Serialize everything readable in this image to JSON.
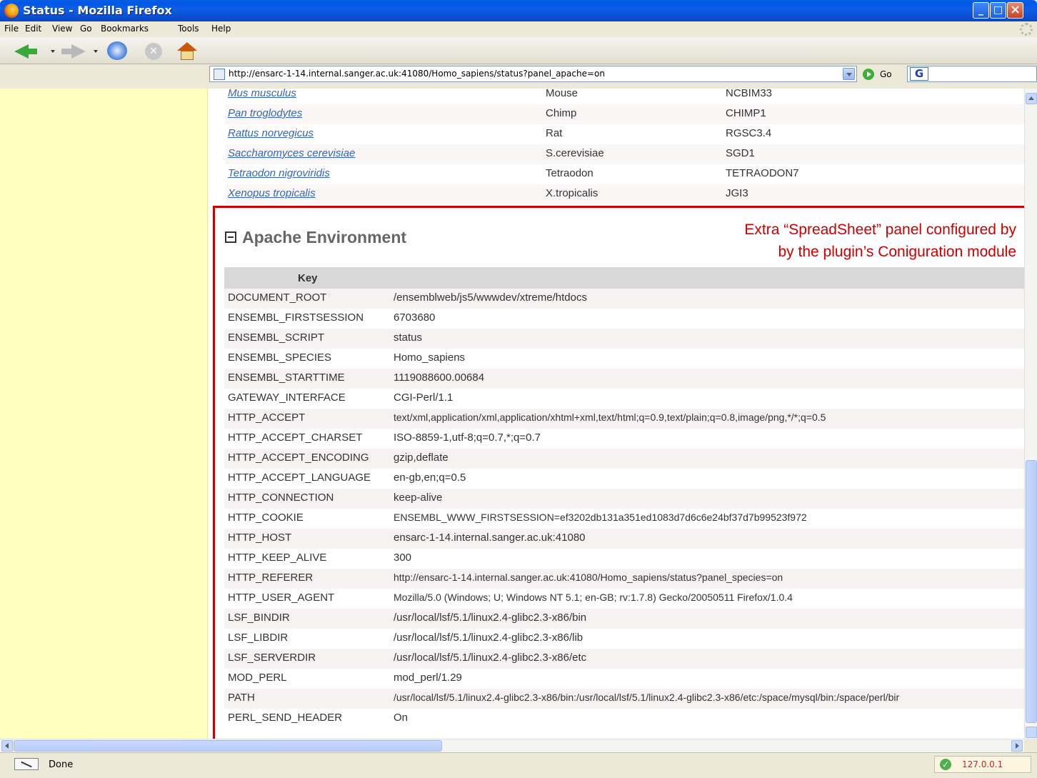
{
  "window": {
    "title": "Status - Mozilla Firefox"
  },
  "menu": [
    "File",
    "Edit",
    "View",
    "Go",
    "Bookmarks",
    "Tools",
    "Help"
  ],
  "toolbar": {
    "url": "http://ensarc-1-14.internal.sanger.ac.uk:41080/Homo_sapiens/status?panel_apache=on",
    "go_label": "Go",
    "search_logo": "G"
  },
  "species": [
    {
      "name": "Mus musculus",
      "common": "Mouse",
      "assembly": "NCBIM33"
    },
    {
      "name": "Pan troglodytes",
      "common": "Chimp",
      "assembly": "CHIMP1"
    },
    {
      "name": "Rattus norvegicus",
      "common": "Rat",
      "assembly": "RGSC3.4"
    },
    {
      "name": "Saccharomyces cerevisiae",
      "common": "S.cerevisiae",
      "assembly": "SGD1"
    },
    {
      "name": "Tetraodon nigroviridis",
      "common": "Tetraodon",
      "assembly": "TETRAODON7"
    },
    {
      "name": "Xenopus tropicalis",
      "common": "X.tropicalis",
      "assembly": "JGI3"
    }
  ],
  "panel": {
    "title": "Apache Environment",
    "key_header": "Key",
    "rows": [
      {
        "key": "DOCUMENT_ROOT",
        "value": "/ensemblweb/js5/wwwdev/xtreme/htdocs"
      },
      {
        "key": "ENSEMBL_FIRSTSESSION",
        "value": "6703680"
      },
      {
        "key": "ENSEMBL_SCRIPT",
        "value": "status"
      },
      {
        "key": "ENSEMBL_SPECIES",
        "value": "Homo_sapiens"
      },
      {
        "key": "ENSEMBL_STARTTIME",
        "value": "1119088600.00684"
      },
      {
        "key": "GATEWAY_INTERFACE",
        "value": "CGI-Perl/1.1"
      },
      {
        "key": "HTTP_ACCEPT",
        "value": "text/xml,application/xml,application/xhtml+xml,text/html;q=0.9,text/plain;q=0.8,image/png,*/*;q=0.5"
      },
      {
        "key": "HTTP_ACCEPT_CHARSET",
        "value": "ISO-8859-1,utf-8;q=0.7,*;q=0.7"
      },
      {
        "key": "HTTP_ACCEPT_ENCODING",
        "value": "gzip,deflate"
      },
      {
        "key": "HTTP_ACCEPT_LANGUAGE",
        "value": "en-gb,en;q=0.5"
      },
      {
        "key": "HTTP_CONNECTION",
        "value": "keep-alive"
      },
      {
        "key": "HTTP_COOKIE",
        "value": "ENSEMBL_WWW_FIRSTSESSION=ef3202db131a351ed1083d7d6c6e24bf37d7b99523f972"
      },
      {
        "key": "HTTP_HOST",
        "value": "ensarc-1-14.internal.sanger.ac.uk:41080"
      },
      {
        "key": "HTTP_KEEP_ALIVE",
        "value": "300"
      },
      {
        "key": "HTTP_REFERER",
        "value": "http://ensarc-1-14.internal.sanger.ac.uk:41080/Homo_sapiens/status?panel_species=on"
      },
      {
        "key": "HTTP_USER_AGENT",
        "value": "Mozilla/5.0 (Windows; U; Windows NT 5.1; en-GB; rv:1.7.8) Gecko/20050511 Firefox/1.0.4"
      },
      {
        "key": "LSF_BINDIR",
        "value": "/usr/local/lsf/5.1/linux2.4-glibc2.3-x86/bin"
      },
      {
        "key": "LSF_LIBDIR",
        "value": "/usr/local/lsf/5.1/linux2.4-glibc2.3-x86/lib"
      },
      {
        "key": "LSF_SERVERDIR",
        "value": "/usr/local/lsf/5.1/linux2.4-glibc2.3-x86/etc"
      },
      {
        "key": "MOD_PERL",
        "value": "mod_perl/1.29"
      },
      {
        "key": "PATH",
        "value": "/usr/local/lsf/5.1/linux2.4-glibc2.3-x86/bin:/usr/local/lsf/5.1/linux2.4-glibc2.3-x86/etc:/space/mysql/bin:/space/perl/bir"
      },
      {
        "key": "PERL_SEND_HEADER",
        "value": "On"
      }
    ]
  },
  "annotation": {
    "line1": "Extra “SpreadSheet” panel configured by",
    "line2": "by the plugin’s Coniguration module",
    "color": "#cc0000"
  },
  "status": {
    "text": "Done",
    "host": "127.0.0.1"
  },
  "colors": {
    "link": "#3366bb",
    "sidebar": "#ffffc0",
    "header_row": "#d8d8d8"
  }
}
